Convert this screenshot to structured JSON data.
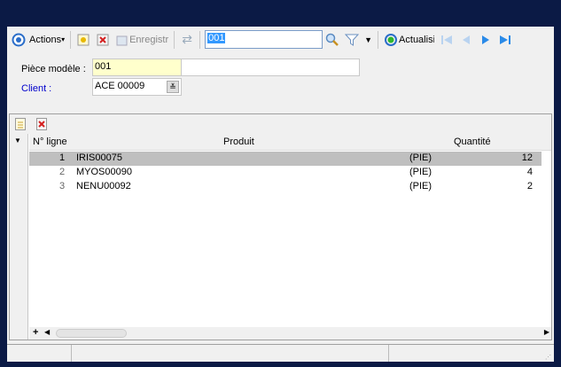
{
  "toolbar": {
    "actions": "Actions",
    "save": "Enregistr",
    "search_value": "001",
    "refresh": "Actualisi"
  },
  "form": {
    "piece_label": "Pièce modèle :",
    "piece_value": "001",
    "client_label": "Client :",
    "client_value": "ACE 00009"
  },
  "grid": {
    "columns": [
      "N° ligne",
      "Produit",
      "Quantité"
    ],
    "rows": [
      {
        "n": "1",
        "product": "IRIS00075",
        "unit": "(PIE)",
        "qty": "12"
      },
      {
        "n": "2",
        "product": "MYOS00090",
        "unit": "(PIE)",
        "qty": "4"
      },
      {
        "n": "3",
        "product": "NENU00092",
        "unit": "(PIE)",
        "qty": "2"
      }
    ],
    "add": "+"
  },
  "colors": {
    "bg": "#0b1a45",
    "selected_row": "#bfbfbf",
    "client_label": "#0000cc",
    "piece_bg": "#ffffcc"
  }
}
